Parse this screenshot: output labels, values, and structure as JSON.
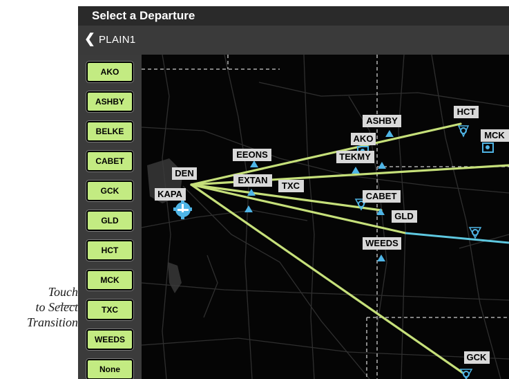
{
  "header": {
    "title": "Select a Departure"
  },
  "procedure": {
    "back_glyph": "❮",
    "name": "PLAIN1"
  },
  "transitions": [
    {
      "label": "AKO"
    },
    {
      "label": "ASHBY"
    },
    {
      "label": "BELKE"
    },
    {
      "label": "CABET"
    },
    {
      "label": "GCK"
    },
    {
      "label": "GLD"
    },
    {
      "label": "HCT"
    },
    {
      "label": "MCK"
    },
    {
      "label": "TXC"
    },
    {
      "label": "WEEDS"
    },
    {
      "label": "None"
    }
  ],
  "callout": {
    "line1": "Touch",
    "line2": "to Select",
    "line3": "Transition"
  },
  "map": {
    "airport": "KAPA",
    "waypoints": [
      {
        "id": "den",
        "label": "DEN"
      },
      {
        "id": "kapa",
        "label": "KAPA"
      },
      {
        "id": "eeons",
        "label": "EEONS"
      },
      {
        "id": "ako",
        "label": "AKO"
      },
      {
        "id": "ashby",
        "label": "ASHBY"
      },
      {
        "id": "hct",
        "label": "HCT"
      },
      {
        "id": "mck",
        "label": "MCK"
      },
      {
        "id": "tekmy",
        "label": "TEKMY"
      },
      {
        "id": "extan",
        "label": "EXTAN"
      },
      {
        "id": "txc",
        "label": "TXC"
      },
      {
        "id": "cabet",
        "label": "CABET"
      },
      {
        "id": "gld",
        "label": "GLD"
      },
      {
        "id": "weeds",
        "label": "WEEDS"
      },
      {
        "id": "gck",
        "label": "GCK"
      }
    ],
    "colors": {
      "route": "#c6e07a",
      "route_active": "#5ec8e0",
      "fix": "#4fb5e6",
      "label_bg": "#d9d9d9"
    }
  }
}
